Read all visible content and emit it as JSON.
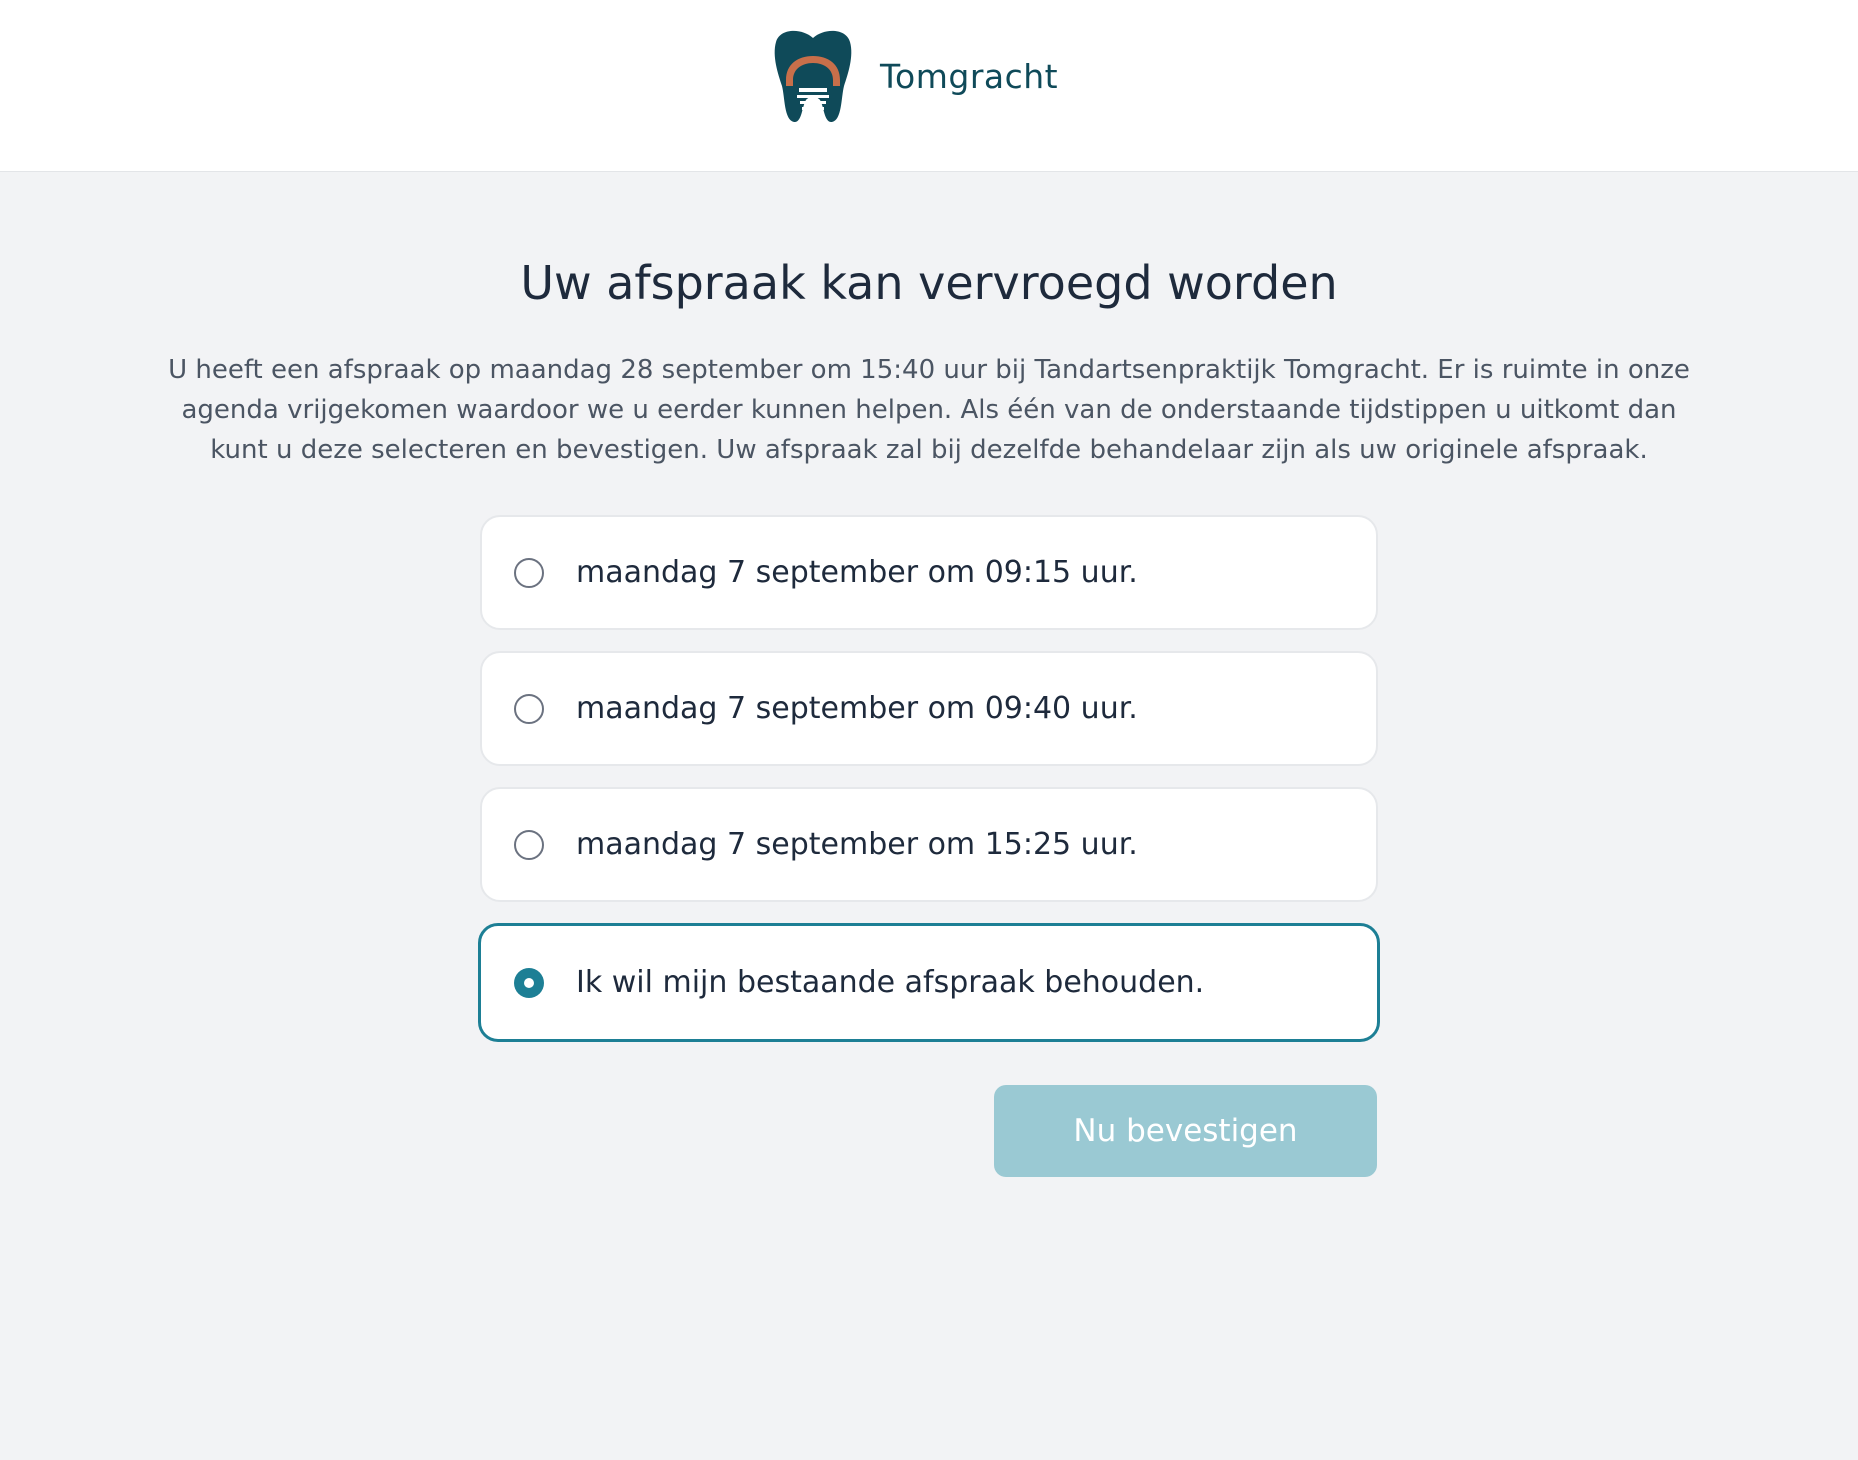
{
  "header": {
    "brand_name": "Tomgracht",
    "logo_icon": "tooth-icon"
  },
  "main": {
    "title": "Uw afspraak kan vervroegd worden",
    "intro": "U heeft een afspraak op maandag 28 september om 15:40 uur bij Tandartsenpraktijk Tomgracht. Er is ruimte in onze agenda vrijgekomen waardoor we u eerder kunnen helpen. Als één van de onderstaande tijdstippen u uitkomt dan kunt u deze selecteren en bevestigen. Uw afspraak zal bij dezelfde behandelaar zijn als uw originele afspraak.",
    "options": [
      {
        "label": "maandag 7 september om 09:15 uur.",
        "selected": false
      },
      {
        "label": "maandag 7 september om 09:40 uur.",
        "selected": false
      },
      {
        "label": "maandag 7 september om 15:25 uur.",
        "selected": false
      },
      {
        "label": "Ik wil mijn bestaande afspraak behouden.",
        "selected": true
      }
    ],
    "confirm_label": "Nu bevestigen"
  },
  "colors": {
    "brand": "#0f4a59",
    "accent": "#1d7f95",
    "button_disabled": "#9ac9d3",
    "logo_arch": "#c86f4a",
    "page_background": "#f2f3f5"
  }
}
